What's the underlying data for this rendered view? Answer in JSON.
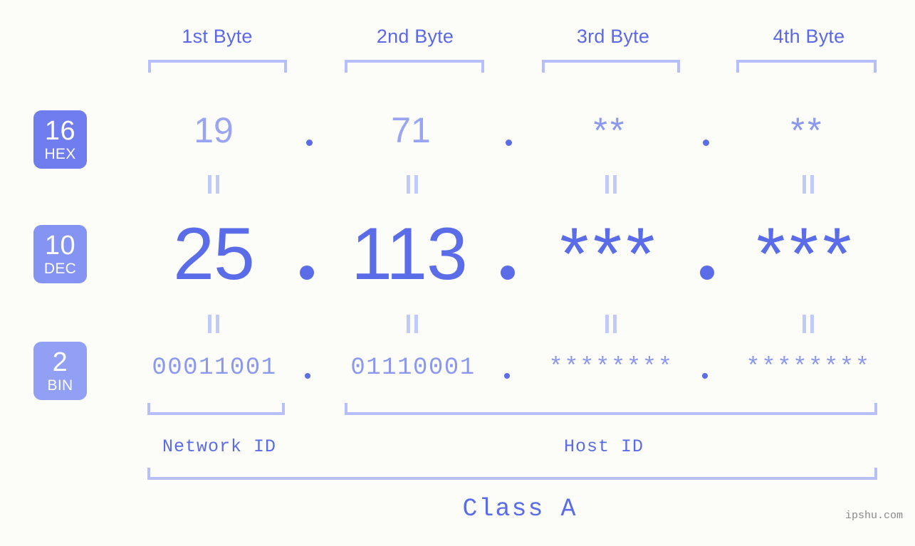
{
  "page": {
    "background_color": "#fcfdf9",
    "accent_color": "#5b6ce8",
    "light_accent_color": "#b6bffb",
    "watermark": "ipshu.com"
  },
  "byte_headers": [
    {
      "label": "1st Byte"
    },
    {
      "label": "2nd Byte"
    },
    {
      "label": "3rd Byte"
    },
    {
      "label": "4th Byte"
    }
  ],
  "bases": [
    {
      "number": "16",
      "name": "HEX",
      "color": "#6f7dee"
    },
    {
      "number": "10",
      "name": "DEC",
      "color": "#8593f2"
    },
    {
      "number": "2",
      "name": "BIN",
      "color": "#91a0f5"
    }
  ],
  "rows": {
    "hex": {
      "values": [
        "19",
        "71",
        "**",
        "**"
      ],
      "separator": "."
    },
    "dec": {
      "values": [
        "25",
        "113",
        "***",
        "***"
      ],
      "separator": "."
    },
    "bin": {
      "values": [
        "00011001",
        "01110001",
        "********",
        "********"
      ],
      "separator": "."
    }
  },
  "equals_marks": {
    "glyph": "||",
    "count_per_row": 4
  },
  "groups": [
    {
      "label": "Network ID"
    },
    {
      "label": "Host ID"
    }
  ],
  "class": {
    "label": "Class A"
  }
}
